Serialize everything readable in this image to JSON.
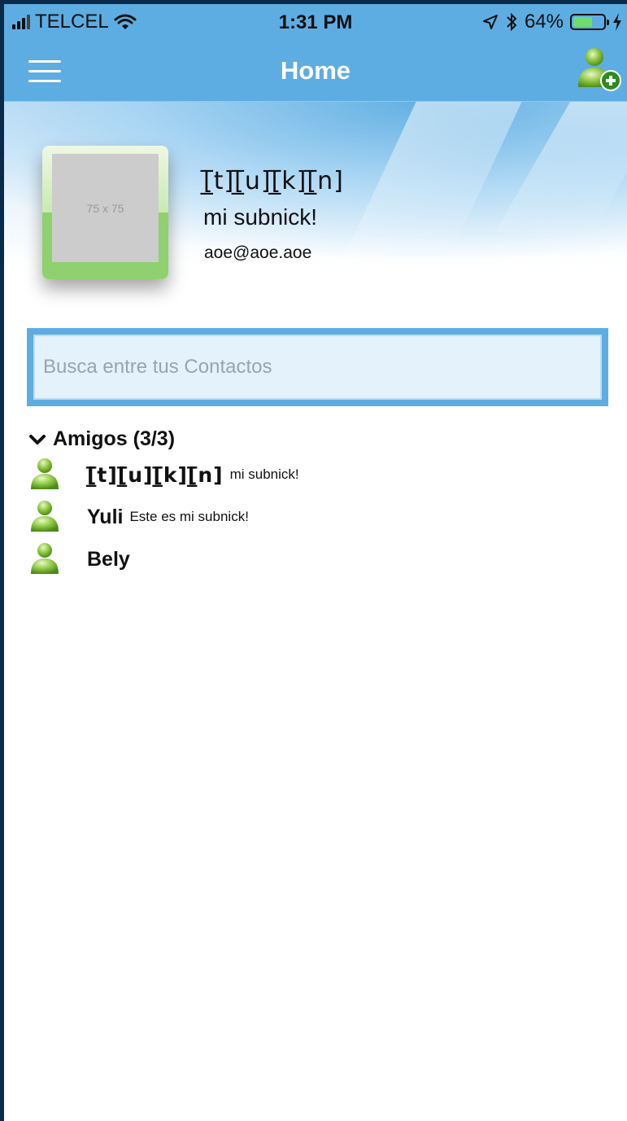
{
  "status_bar": {
    "carrier": "TELCEL",
    "time": "1:31 PM",
    "battery": "64%",
    "battery_level": 0.64
  },
  "nav": {
    "title": "Home",
    "menu_icon": "hamburger-icon",
    "add_icon": "add-contact-icon"
  },
  "profile": {
    "avatar_placeholder": "75 x 75",
    "name": "[̲̅t][̲̅u][̲̅k][̲̅n]",
    "subnick": "mi subnick!",
    "email": "aoe@aoe.aoe"
  },
  "search": {
    "placeholder": "Busca entre tus Contactos"
  },
  "group": {
    "title": "Amigos (3/3)",
    "contacts": [
      {
        "name": "[̲̅t][̲̅u][̲̅k][̲̅n]",
        "subnick": "mi subnick!"
      },
      {
        "name": "Yuli",
        "subnick": "Este es mi subnick!"
      },
      {
        "name": "Bely",
        "subnick": ""
      }
    ]
  },
  "colors": {
    "accent": "#5dade2",
    "avatar_green": "#8fd16e"
  }
}
